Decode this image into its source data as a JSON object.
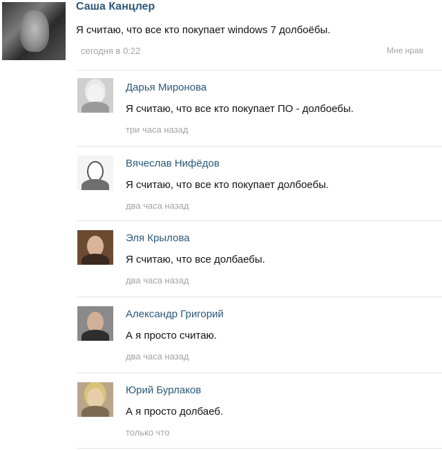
{
  "post": {
    "author": "Саша Канцлер",
    "text": "Я считаю, что все кто покупает windows 7 долбоёбы.",
    "time": "сегодня в 0:22",
    "like_label": "Мне нрав"
  },
  "comments": [
    {
      "author": "Дарья Миронова",
      "text": "Я считаю, что все кто покупает ПО - долбоебы.",
      "time": "три часа назад"
    },
    {
      "author": "Вячеслав Нифёдов",
      "text": "Я считаю, что все кто покупает долбоебы.",
      "time": "два часа назад"
    },
    {
      "author": "Эля Крылова",
      "text": "Я считаю, что все долбаебы.",
      "time": "два часа назад"
    },
    {
      "author": "Александр Григорий",
      "text": "А я просто считаю.",
      "time": "два часа назад"
    },
    {
      "author": "Юрий Бурлаков",
      "text": "А я просто долбаеб.",
      "time": "только что"
    }
  ],
  "colors": {
    "name_link": "#2b587a",
    "timestamp": "#a3a3a3",
    "separator": "#e3e3e3"
  }
}
